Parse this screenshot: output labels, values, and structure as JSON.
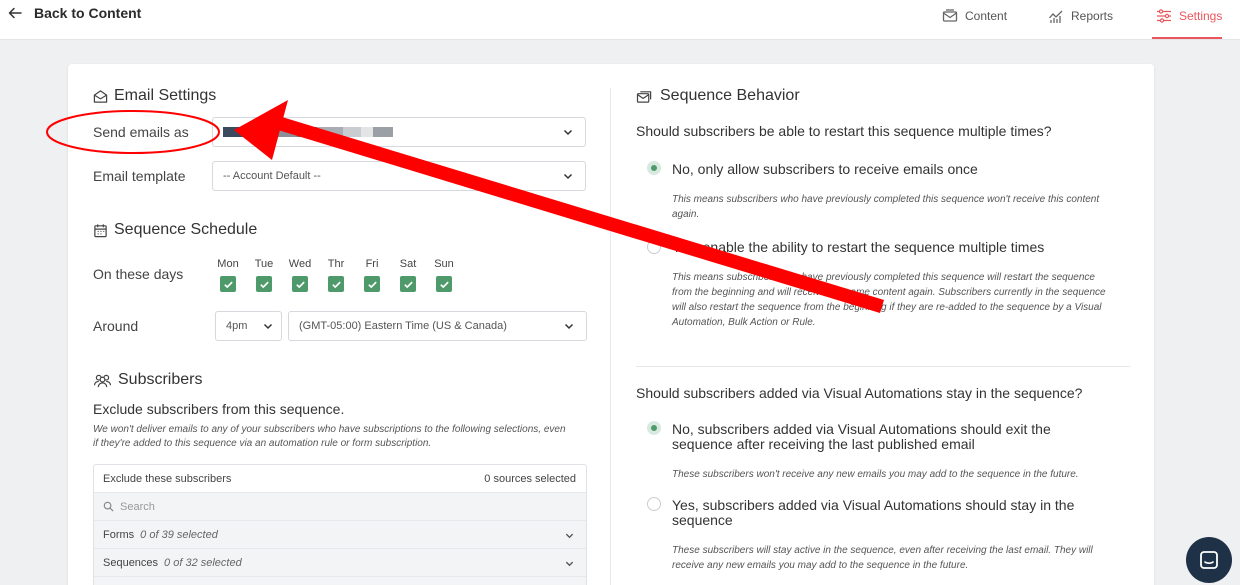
{
  "header": {
    "back_label": "Back to Content",
    "tabs": [
      {
        "label": "Content",
        "icon": "envelope-icon",
        "active": false
      },
      {
        "label": "Reports",
        "icon": "chart-icon",
        "active": false
      },
      {
        "label": "Settings",
        "icon": "sliders-icon",
        "active": true
      }
    ],
    "accent_color": "#e8565c"
  },
  "email_settings": {
    "title": "Email Settings",
    "send_as_label": "Send emails as",
    "send_as_value_redacted": true,
    "template_label": "Email template",
    "template_value": "-- Account Default --"
  },
  "schedule": {
    "title": "Sequence Schedule",
    "days_label": "On these days",
    "days": [
      "Mon",
      "Tue",
      "Wed",
      "Thr",
      "Fri",
      "Sat",
      "Sun"
    ],
    "days_checked": [
      true,
      true,
      true,
      true,
      true,
      true,
      true
    ],
    "around_label": "Around",
    "time_value": "4pm",
    "timezone_value": "(GMT-05:00) Eastern Time (US & Canada)"
  },
  "subscribers": {
    "title": "Subscribers",
    "exclude_heading": "Exclude subscribers from this sequence.",
    "exclude_note_line1": "We won't deliver emails to any of your subscribers who have subscriptions to the following selections, even",
    "exclude_note_line2": "if they're added to this sequence via an automation rule or form subscription.",
    "table": {
      "header_label": "Exclude these subscribers",
      "header_count": "0 sources selected",
      "search_placeholder": "Search",
      "rows": [
        {
          "label": "Forms",
          "count": "0 of 39 selected"
        },
        {
          "label": "Sequences",
          "count": "0 of 32 selected"
        }
      ]
    }
  },
  "behavior": {
    "title": "Sequence Behavior",
    "q1": "Should subscribers be able to restart this sequence multiple times?",
    "q1_option1": "No, only allow subscribers to receive emails once",
    "q1_option1_note_l1": "This means subscribers who have previously completed this sequence won't receive this content",
    "q1_option1_note_l2": "again.",
    "q1_option2": "Yes, enable the ability to restart the sequence multiple times",
    "q1_option2_note_l1": "This means subscribers who have previously completed this sequence will restart the sequence",
    "q1_option2_note_l2": "from the beginning and will receive the same content again. Subscribers currently in the sequence",
    "q1_option2_note_l3": "will also restart the sequence from the beginning if they are re-added to the sequence by a Visual",
    "q1_option2_note_l4": "Automation, Bulk Action or Rule.",
    "q1_selected": 1,
    "q2": "Should subscribers added via Visual Automations stay in the sequence?",
    "q2_option1_l1": "No, subscribers added via Visual Automations should exit the",
    "q2_option1_l2": "sequence after receiving the last published email",
    "q2_option1_note": "These subscribers won't receive any new emails you may add to the sequence in the future.",
    "q2_option2_l1": "Yes, subscribers added via Visual Automations should stay in the",
    "q2_option2_l2": "sequence",
    "q2_option2_note_l1": "These subscribers will stay active in the sequence, even after receiving the last email. They will",
    "q2_option2_note_l2": "receive any new emails you may add to the sequence in the future.",
    "q2_selected": 1,
    "radio_color": "#4e9a6a"
  },
  "annotation": {
    "color": "#ff0000",
    "shapes": [
      "ellipse",
      "arrow"
    ]
  },
  "chat_icon": "chat-icon"
}
